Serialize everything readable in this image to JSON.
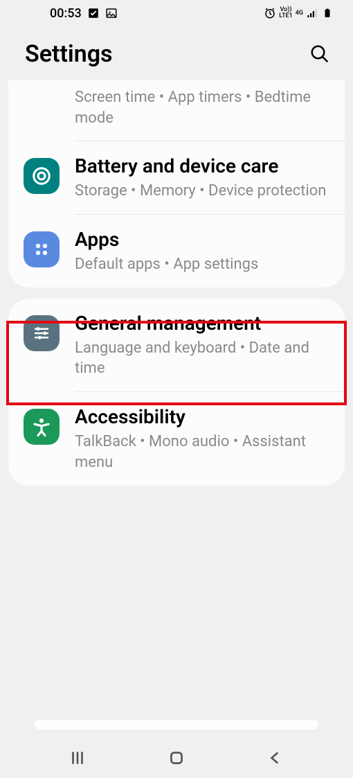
{
  "status": {
    "time": "00:53",
    "network_label": "Vo))\nLTE1",
    "signal_label": "4G"
  },
  "header": {
    "title": "Settings"
  },
  "group1": {
    "partial": {
      "sub": "Screen time  •  App timers  •  Bedtime mode"
    },
    "battery": {
      "title": "Battery and device care",
      "sub": "Storage  •  Memory  •  Device protection"
    },
    "apps": {
      "title": "Apps",
      "sub": "Default apps  •  App settings"
    }
  },
  "group2": {
    "general": {
      "title": "General management",
      "sub": "Language and keyboard  •  Date and time"
    },
    "a11y": {
      "title": "Accessibility",
      "sub": "TalkBack  •  Mono audio  •  Assistant menu"
    }
  }
}
